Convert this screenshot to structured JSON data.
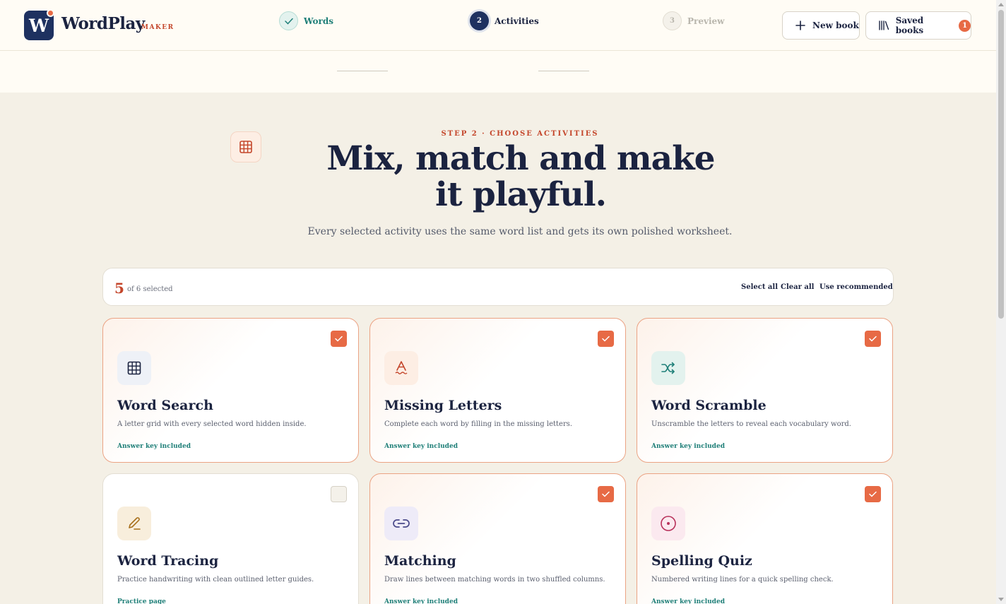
{
  "header": {
    "brand_name": "WordPlay",
    "brand_sub": "MAKER",
    "logo_letter": "W",
    "new_book_label": "New book",
    "saved_books_label": "Saved books",
    "saved_count": "1"
  },
  "stepper": {
    "steps": [
      {
        "label": "Words",
        "marker": "✓",
        "state": "done"
      },
      {
        "label": "Activities",
        "marker": "2",
        "state": "current"
      },
      {
        "label": "Preview",
        "marker": "3",
        "state": "upcoming"
      }
    ]
  },
  "hero": {
    "eyebrow": "STEP 2 · CHOOSE ACTIVITIES",
    "title": "Mix, match and make it playful.",
    "subtitle": "Every selected activity uses the same word list and gets its own polished worksheet."
  },
  "selection": {
    "count": "5",
    "of_text": "of 6 selected",
    "select_all": "Select all",
    "clear_all": "Clear all",
    "use_recommended": "Use recommended"
  },
  "activities": [
    {
      "title": "Word Search",
      "desc": "A letter grid with every selected word hidden inside.",
      "foot": "Answer key included",
      "selected": true,
      "icon": "grid-icon",
      "icon_bg": "#eef1f7",
      "icon_color": "#1b2340"
    },
    {
      "title": "Missing Letters",
      "desc": "Complete each word by filling in the missing letters.",
      "foot": "Answer key included",
      "selected": true,
      "icon": "letter-a-icon",
      "icon_bg": "#fdeee4",
      "icon_color": "#c4462b"
    },
    {
      "title": "Word Scramble",
      "desc": "Unscramble the letters to reveal each vocabulary word.",
      "foot": "Answer key included",
      "selected": true,
      "icon": "shuffle-icon",
      "icon_bg": "#e3f2ee",
      "icon_color": "#1f7f78"
    },
    {
      "title": "Word Tracing",
      "desc": "Practice handwriting with clean outlined letter guides.",
      "foot": "Practice page",
      "selected": false,
      "icon": "pencil-icon",
      "icon_bg": "#f8eedc",
      "icon_color": "#a8701c"
    },
    {
      "title": "Matching",
      "desc": "Draw lines between matching words in two shuffled columns.",
      "foot": "Answer key included",
      "selected": true,
      "icon": "link-icon",
      "icon_bg": "#eeebf8",
      "icon_color": "#4b4a8a"
    },
    {
      "title": "Spelling Quiz",
      "desc": "Numbered writing lines for a quick spelling check.",
      "foot": "Answer key included",
      "selected": true,
      "icon": "target-icon",
      "icon_bg": "#fbe9ef",
      "icon_color": "#b8305a"
    }
  ],
  "colors": {
    "accent": "#e76a45",
    "navy": "#1e3160",
    "teal": "#1f7f78"
  }
}
